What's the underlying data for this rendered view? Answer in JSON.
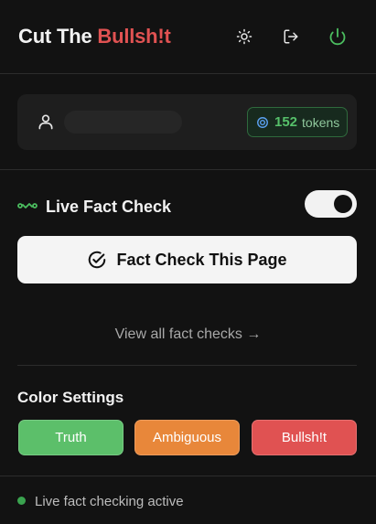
{
  "header": {
    "brand_prefix": "Cut The ",
    "brand_accent": "Bullsh!t",
    "buttons": [
      "theme-toggle",
      "logout",
      "power"
    ]
  },
  "user": {
    "name": "",
    "tokens_count": "152",
    "tokens_unit": "tokens"
  },
  "live_fact_check": {
    "label": "Live Fact Check",
    "enabled": true
  },
  "fact_check_button": {
    "label": "Fact Check This Page"
  },
  "view_all": {
    "label": "View all fact checks →"
  },
  "color_settings": {
    "title": "Color Settings",
    "swatches": [
      {
        "label": "Truth",
        "color": "#5cbf6a"
      },
      {
        "label": "Ambiguous",
        "color": "#e8873a"
      },
      {
        "label": "Bullsh!t",
        "color": "#e05252"
      }
    ]
  },
  "status": {
    "text": "Live fact checking active",
    "color": "#3aa34f"
  },
  "colors": {
    "background": "#121212",
    "accent_red": "#e05252",
    "power_green": "#4bbd5f"
  }
}
